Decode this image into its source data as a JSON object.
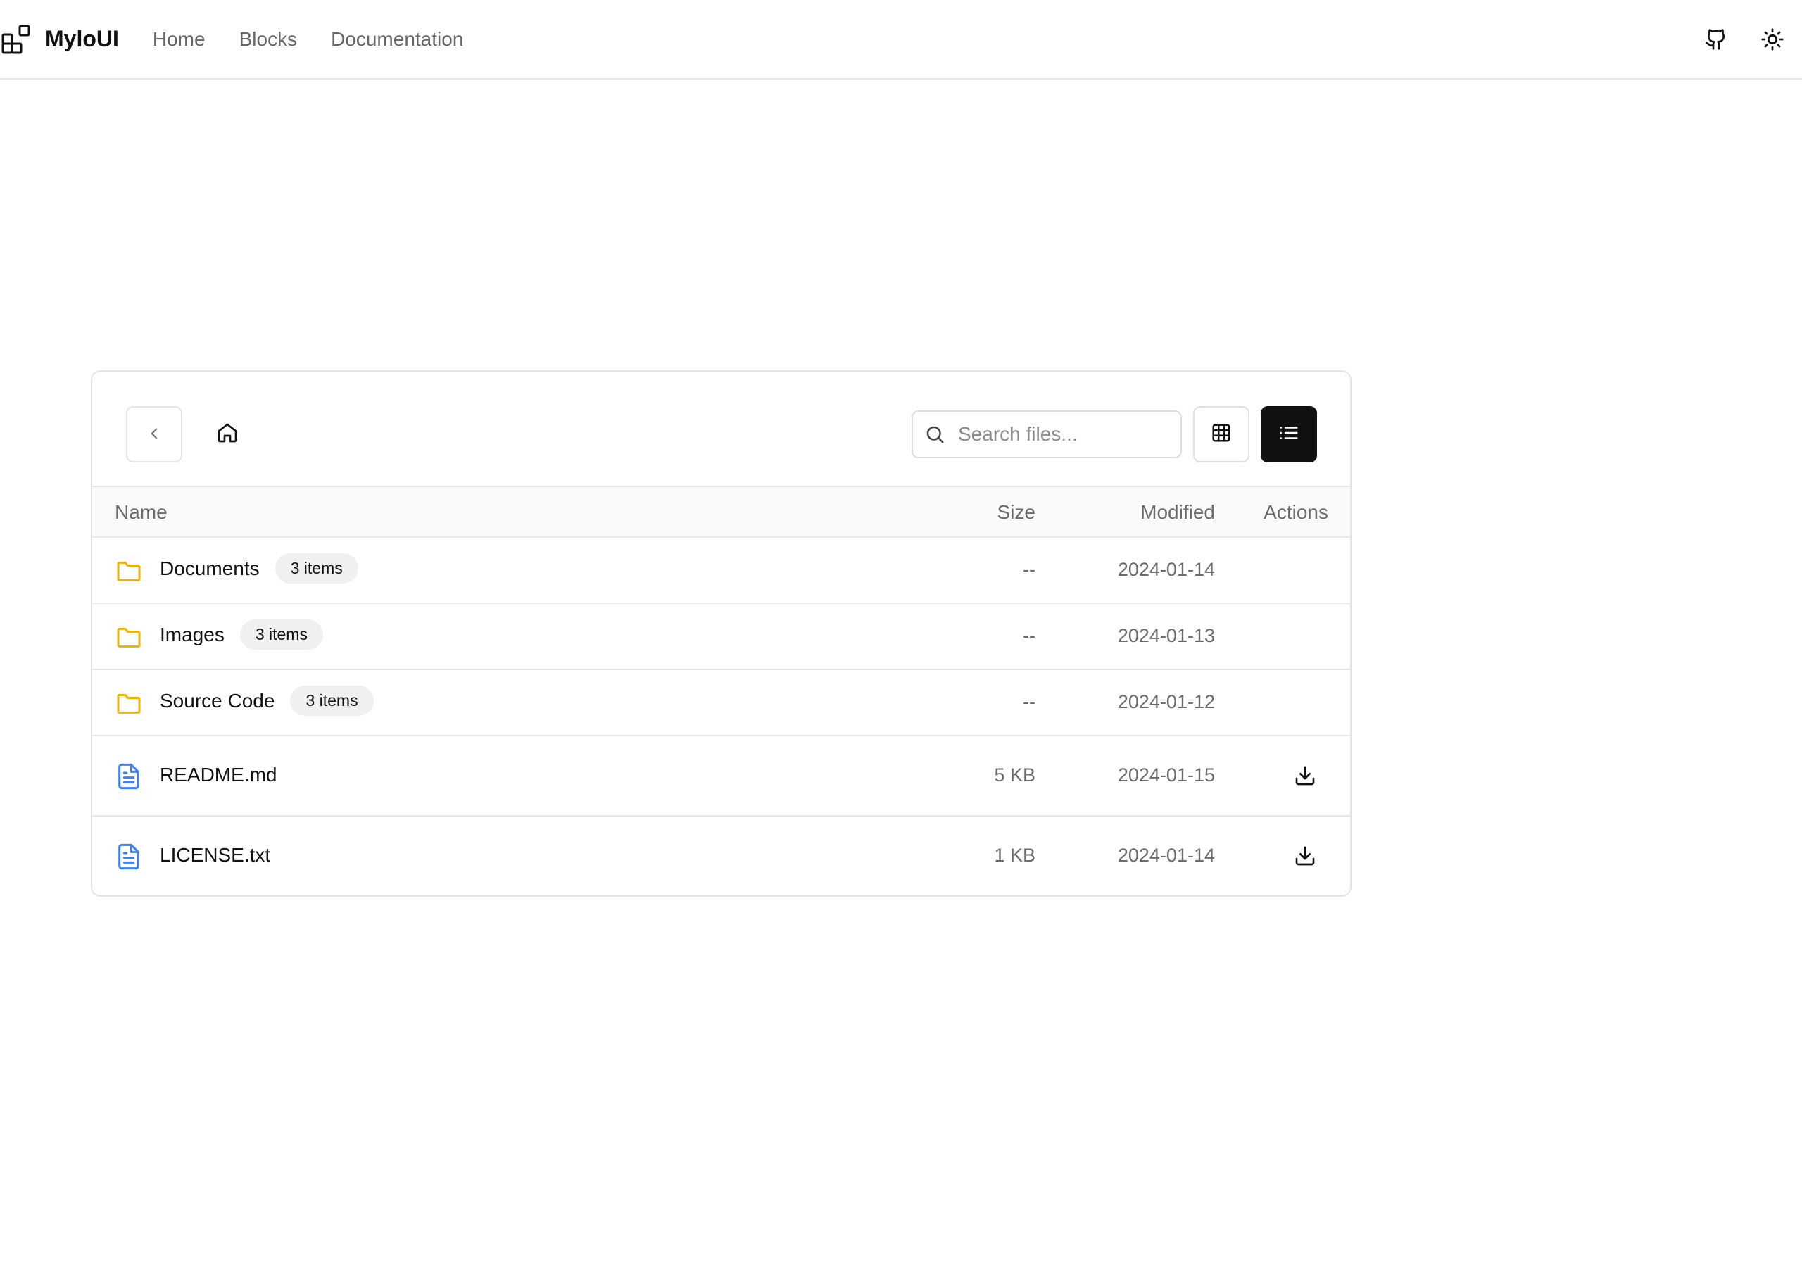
{
  "header": {
    "brand": "MyloUI",
    "nav": [
      "Home",
      "Blocks",
      "Documentation"
    ],
    "icons": [
      "github-icon",
      "sun-icon"
    ]
  },
  "browser": {
    "search_placeholder": "Search files...",
    "search_value": "",
    "active_view": "list",
    "columns": {
      "name": "Name",
      "size": "Size",
      "modified": "Modified",
      "actions": "Actions"
    },
    "folders": [
      {
        "name": "Documents",
        "badge": "3 items",
        "size": "--",
        "modified": "2024-01-14"
      },
      {
        "name": "Images",
        "badge": "3 items",
        "size": "--",
        "modified": "2024-01-13"
      },
      {
        "name": "Source Code",
        "badge": "3 items",
        "size": "--",
        "modified": "2024-01-12"
      }
    ],
    "files": [
      {
        "name": "README.md",
        "size": "5 KB",
        "modified": "2024-01-15"
      },
      {
        "name": "LICENSE.txt",
        "size": "1 KB",
        "modified": "2024-01-14"
      }
    ]
  },
  "colors": {
    "folder": "#EAB308",
    "file": "#3B82F6",
    "active_toggle": "#111111",
    "border": "#E6E6E6",
    "muted_text": "#6B6B6B"
  }
}
